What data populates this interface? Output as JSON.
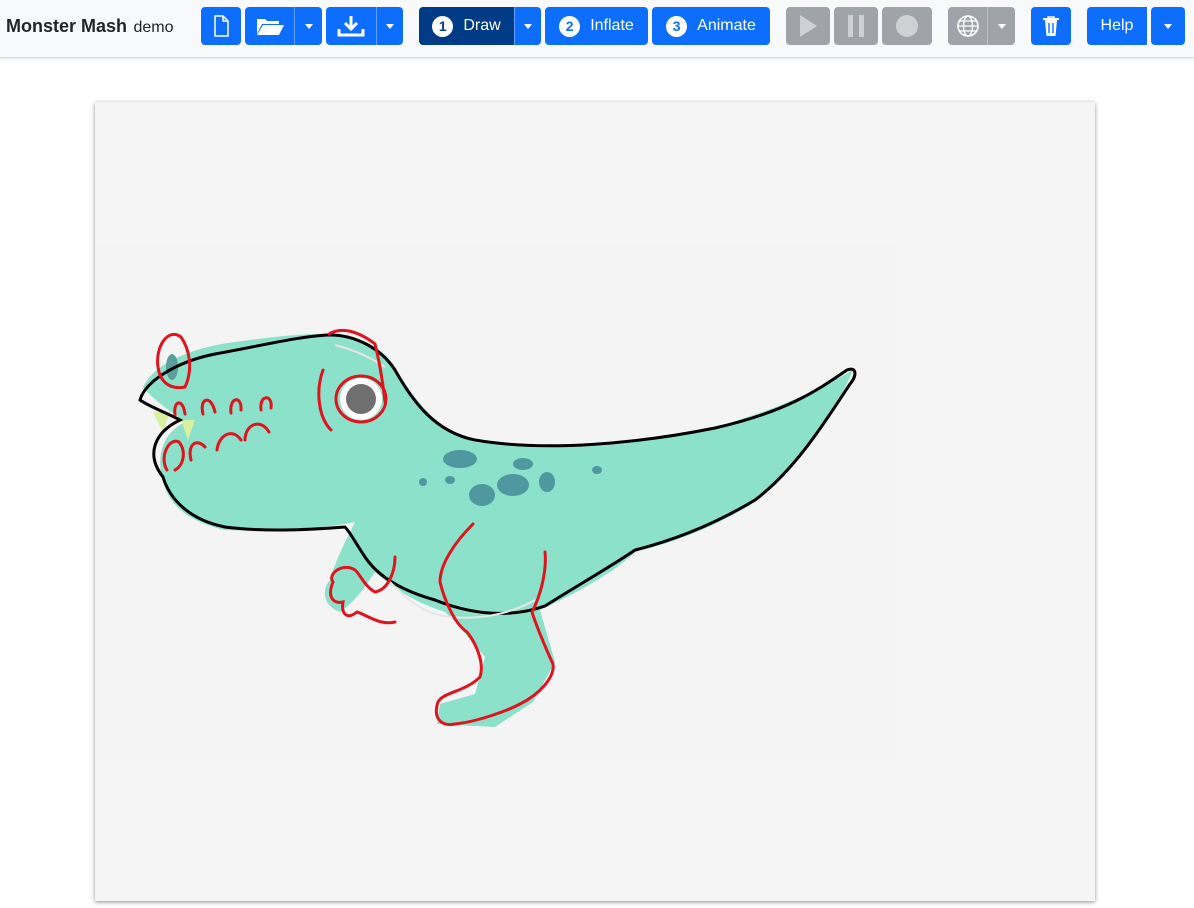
{
  "app": {
    "title": "Monster Mash",
    "subtitle": "demo"
  },
  "toolbar": {
    "icons": {
      "new": "file-icon",
      "open": "folder-open-icon",
      "save": "download-icon",
      "play": "play-icon",
      "pause": "pause-icon",
      "record": "record-icon",
      "language": "globe-icon",
      "delete": "trash-icon"
    },
    "modes": [
      {
        "number": "1",
        "label": "Draw",
        "active": true
      },
      {
        "number": "2",
        "label": "Inflate",
        "active": false
      },
      {
        "number": "3",
        "label": "Animate",
        "active": false
      }
    ],
    "help_label": "Help",
    "playback_enabled": false
  },
  "colors": {
    "primary": "#0d6efd",
    "active_mode": "#003b87",
    "disabled": "#a0a4a8",
    "outline_stroke": "#000000",
    "part_stroke": "#e0141e",
    "creature_fill": "#7fdfc4"
  }
}
